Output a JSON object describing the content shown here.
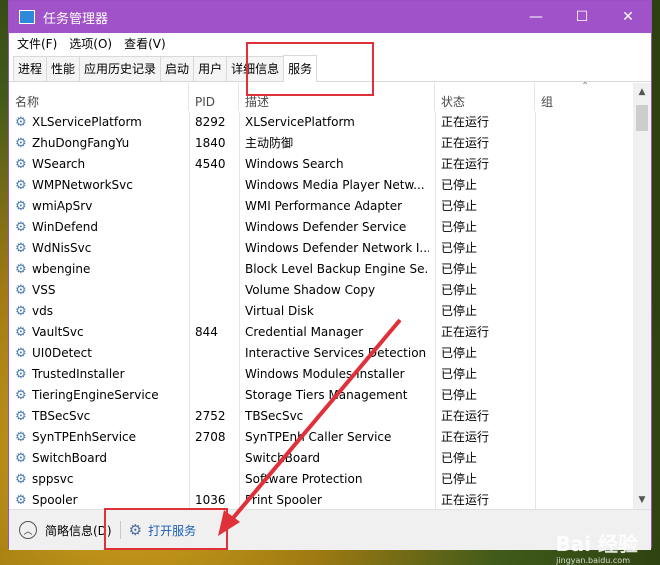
{
  "window": {
    "title": "任务管理器",
    "controls": {
      "minimize": "—",
      "maximize": "☐",
      "close": "✕"
    }
  },
  "menu": [
    "文件(F)",
    "选项(O)",
    "查看(V)"
  ],
  "tabs": [
    {
      "label": "进程",
      "active": false
    },
    {
      "label": "性能",
      "active": false
    },
    {
      "label": "应用历史记录",
      "active": false
    },
    {
      "label": "启动",
      "active": false
    },
    {
      "label": "用户",
      "active": false
    },
    {
      "label": "详细信息",
      "active": false
    },
    {
      "label": "服务",
      "active": true
    }
  ],
  "columns": {
    "name": "名称",
    "pid": "PID",
    "desc": "描述",
    "status": "状态",
    "group": "组"
  },
  "services": [
    {
      "name": "XLServicePlatform",
      "pid": "8292",
      "desc": "XLServicePlatform",
      "status": "正在运行"
    },
    {
      "name": "ZhuDongFangYu",
      "pid": "1840",
      "desc": "主动防御",
      "status": "正在运行"
    },
    {
      "name": "WSearch",
      "pid": "4540",
      "desc": "Windows Search",
      "status": "正在运行"
    },
    {
      "name": "WMPNetworkSvc",
      "pid": "",
      "desc": "Windows Media Player Netw...",
      "status": "已停止"
    },
    {
      "name": "wmiApSrv",
      "pid": "",
      "desc": "WMI Performance Adapter",
      "status": "已停止"
    },
    {
      "name": "WinDefend",
      "pid": "",
      "desc": "Windows Defender Service",
      "status": "已停止"
    },
    {
      "name": "WdNisSvc",
      "pid": "",
      "desc": "Windows Defender Network I...",
      "status": "已停止"
    },
    {
      "name": "wbengine",
      "pid": "",
      "desc": "Block Level Backup Engine Se...",
      "status": "已停止"
    },
    {
      "name": "VSS",
      "pid": "",
      "desc": "Volume Shadow Copy",
      "status": "已停止"
    },
    {
      "name": "vds",
      "pid": "",
      "desc": "Virtual Disk",
      "status": "已停止"
    },
    {
      "name": "VaultSvc",
      "pid": "844",
      "desc": "Credential Manager",
      "status": "正在运行"
    },
    {
      "name": "UI0Detect",
      "pid": "",
      "desc": "Interactive Services Detection",
      "status": "已停止"
    },
    {
      "name": "TrustedInstaller",
      "pid": "",
      "desc": "Windows Modules Installer",
      "status": "已停止"
    },
    {
      "name": "TieringEngineService",
      "pid": "",
      "desc": "Storage Tiers Management",
      "status": "已停止"
    },
    {
      "name": "TBSecSvc",
      "pid": "2752",
      "desc": "TBSecSvc",
      "status": "正在运行"
    },
    {
      "name": "SynTPEnhService",
      "pid": "2708",
      "desc": "SynTPEnh Caller Service",
      "status": "正在运行"
    },
    {
      "name": "SwitchBoard",
      "pid": "",
      "desc": "SwitchBoard",
      "status": "已停止"
    },
    {
      "name": "sppsvc",
      "pid": "",
      "desc": "Software Protection",
      "status": "已停止"
    },
    {
      "name": "Spooler",
      "pid": "1036",
      "desc": "Print Spooler",
      "status": "正在运行"
    }
  ],
  "footer": {
    "fewer_details": "简略信息(D)",
    "open_services": "打开服务"
  },
  "watermark": {
    "brand": "Bai 经验",
    "url": "jingyan.baidu.com"
  },
  "colors": {
    "titlebar": "#a052c8",
    "highlight": "#e0303a",
    "link": "#1a5fb4"
  }
}
